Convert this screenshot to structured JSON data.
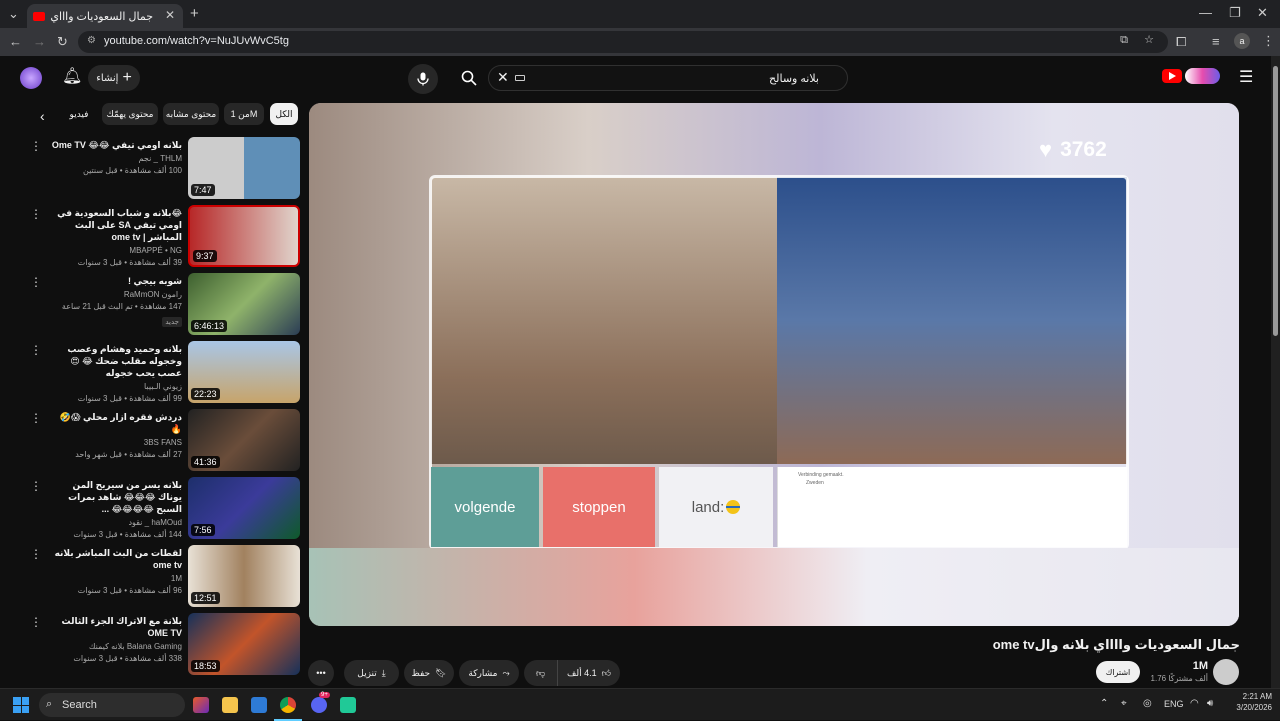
{
  "browser": {
    "tab_title": "جمال السعوديات واااي بلانه و",
    "url": "youtube.com/watch?v=NuJUvWvC5tg",
    "profile_initial": "a"
  },
  "header": {
    "create_label": "إنشاء",
    "search_value": "بلانه وسالح"
  },
  "chips": [
    "الكل",
    "من 1M",
    "محتوى مشابه",
    "محتوى يهمّك",
    "فيديو"
  ],
  "sidebar": {
    "items": [
      {
        "title": "بلانه اومي تيفي 😂😂 Ome TV",
        "channel": "THLM _ نجم",
        "meta": "100 ألف مشاهدة • قبل سنتين",
        "duration": "7:47",
        "badge": ""
      },
      {
        "title": "😂بلانه و شباب السعودية في اومي تيفي SA على البث المباشر | ome tv",
        "channel": "MBAPPÉ • NG",
        "meta": "39 ألف مشاهدة • قبل 3 سنوات",
        "duration": "9:37",
        "badge": ""
      },
      {
        "title": "شوبه بيجي !",
        "channel": "رامون RaMmON",
        "meta": "147 مشاهدة • تم البث قبل 21 ساعة",
        "duration": "6:46:13",
        "badge": "جديد"
      },
      {
        "title": "بلانه وحميد وهشام وعصب وخجوله مقلب ضحك 😂 😍 عصب يحب خجوله",
        "channel": "زيوني الـبيبا",
        "meta": "99 ألف مشاهدة • قبل 3 سنوات",
        "duration": "22:23",
        "badge": ""
      },
      {
        "title": "دردش فقره ازار محلي 😱🤣🔥",
        "channel": "3BS FANS",
        "meta": "27 ألف مشاهدة • قبل شهر واحد",
        "duration": "41:36",
        "badge": ""
      },
      {
        "title": "بلانه يسر من سيريح المن يوناك 😂😂😂 شاهد بمرات السبح 😂😂😂😂 ...",
        "channel": "haMOud _ نقود",
        "meta": "144 ألف مشاهدة • قبل 3 سنوات",
        "duration": "7:56",
        "badge": ""
      },
      {
        "title": "لقطات من البث المباشر بلانه ome tv",
        "channel": "1M",
        "meta": "96 ألف مشاهدة • قبل 3 سنوات",
        "duration": "12:51",
        "badge": ""
      },
      {
        "title": "بلانة مع الاتراك الجزء الثالث OME TV",
        "channel": "Balana Gaming بلانه كيمنك",
        "meta": "338 ألف مشاهدة • قبل 3 سنوات",
        "duration": "18:53",
        "badge": ""
      }
    ]
  },
  "player": {
    "likes_counter": "3762",
    "btn_next": "volgende",
    "btn_stop": "stoppen",
    "btn_land": "land:",
    "notice_line1": "Verbinding gemaakt.",
    "notice_line2": "Zweden"
  },
  "video": {
    "title": "جمال السعوديات وااااي بلانه والome tv",
    "channel_name": "1M",
    "subscribers": "1.76 ألف مشتركًا",
    "subscribe_label": "اشتراك",
    "likes": "4.1 ألف",
    "share_label": "مشاركة",
    "save_label": "حفظ",
    "download_label": "تنزيل"
  },
  "taskbar": {
    "search_label": "Search",
    "lang": "ENG",
    "time": "2:21 AM",
    "date": "3/20/2026",
    "discord_badge": "9+"
  },
  "colors": {
    "youtube_red": "#ff0000",
    "bg": "#0f0f0f"
  }
}
